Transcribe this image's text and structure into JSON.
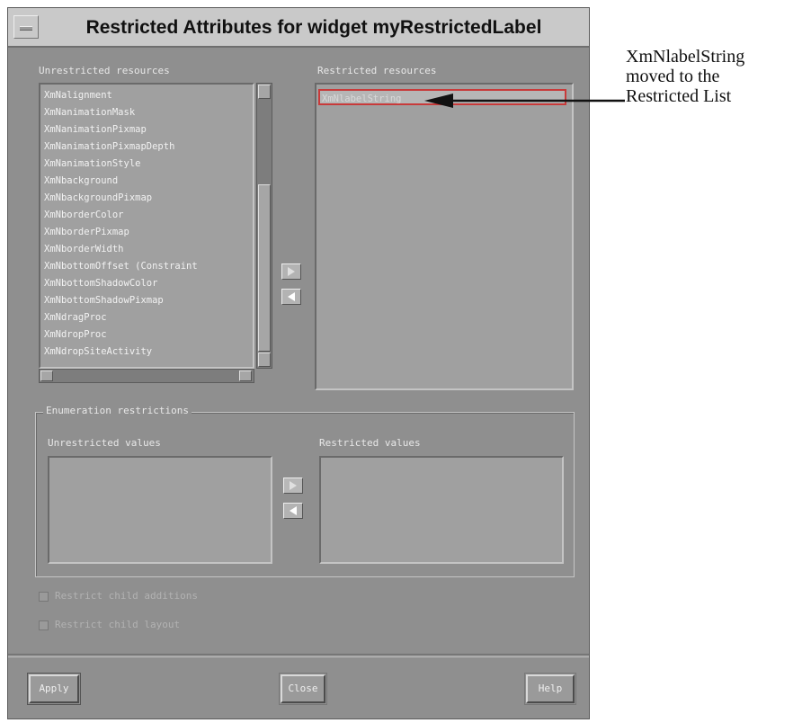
{
  "window": {
    "title": "Restricted Attributes for widget myRestrictedLabel"
  },
  "resources": {
    "unrestricted_label": "Unrestricted resources",
    "restricted_label": "Restricted resources",
    "unrestricted_items": [
      "XmNalignment",
      "XmNanimationMask",
      "XmNanimationPixmap",
      "XmNanimationPixmapDepth",
      "XmNanimationStyle",
      "XmNbackground",
      "XmNbackgroundPixmap",
      "XmNborderColor",
      "XmNborderPixmap",
      "XmNborderWidth",
      "XmNbottomOffset     (Constraint",
      "XmNbottomShadowColor",
      "XmNbottomShadowPixmap",
      "XmNdragProc",
      "XmNdropProc",
      "XmNdropSiteActivity"
    ],
    "restricted_items": [
      "XmNlabelString"
    ]
  },
  "enumeration": {
    "frame_title": "Enumeration restrictions",
    "unrestricted_label": "Unrestricted values",
    "restricted_label": "Restricted values"
  },
  "options": {
    "restrict_child_additions": "Restrict child additions",
    "restrict_child_layout": "Restrict child layout"
  },
  "buttons": {
    "apply": "Apply",
    "close": "Close",
    "help": "Help"
  },
  "annotation": {
    "line1": "XmNlabelString",
    "line2": "moved to the",
    "line3": "Restricted List"
  },
  "colors": {
    "panel": "#8f8f8f",
    "highlight_border": "#c83a3a"
  },
  "icons": [
    "window-menu-icon",
    "move-right-arrow-icon",
    "move-left-arrow-icon",
    "annotation-arrow-icon"
  ]
}
